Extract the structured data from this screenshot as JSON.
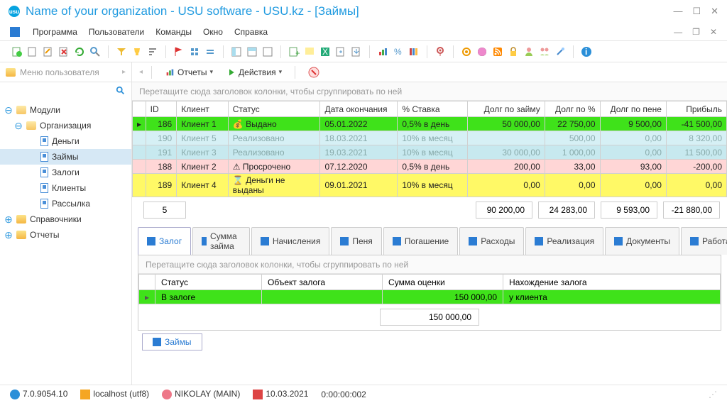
{
  "titlebar": {
    "title": "Name of your organization - USU software - USU.kz - [Займы]"
  },
  "menu": {
    "items": [
      "Программа",
      "Пользователи",
      "Команды",
      "Окно",
      "Справка"
    ]
  },
  "sidebar": {
    "header": "Меню пользователя",
    "items": [
      {
        "label": "Модули",
        "lvl": 0,
        "kind": "folder-open",
        "exp": "⊖"
      },
      {
        "label": "Организация",
        "lvl": 1,
        "kind": "folder-open",
        "exp": "⊖"
      },
      {
        "label": "Деньги",
        "lvl": 2,
        "kind": "doc"
      },
      {
        "label": "Займы",
        "lvl": 2,
        "kind": "doc",
        "sel": true
      },
      {
        "label": "Залоги",
        "lvl": 2,
        "kind": "doc"
      },
      {
        "label": "Клиенты",
        "lvl": 2,
        "kind": "doc"
      },
      {
        "label": "Рассылка",
        "lvl": 2,
        "kind": "doc"
      },
      {
        "label": "Справочники",
        "lvl": 0,
        "kind": "folder",
        "exp": "⊕"
      },
      {
        "label": "Отчеты",
        "lvl": 0,
        "kind": "folder",
        "exp": "⊕"
      }
    ]
  },
  "maintb": {
    "reports": "Отчеты",
    "actions": "Действия"
  },
  "group_hint": "Перетащите сюда заголовок колонки, чтобы сгруппировать по ней",
  "grid": {
    "headers": [
      "ID",
      "Клиент",
      "Статус",
      "Дата окончания",
      "% Ставка",
      "Долг по займу",
      "Долг по %",
      "Долг по пене",
      "Прибыль"
    ],
    "rows": [
      {
        "cls": "row-green",
        "ptr": "▸",
        "id": "186",
        "client": "Клиент 1",
        "status": "Выдано",
        "sicon": "issued",
        "date": "05.01.2022",
        "rate": "0,5% в день",
        "debt": "50 000,00",
        "pct": "22 750,00",
        "pen": "9 500,00",
        "profit": "-41 500,00",
        "pneg": true
      },
      {
        "cls": "row-cyan",
        "ptr": "",
        "id": "190",
        "client": "Клиент 5",
        "status": "Реализовано",
        "sicon": "",
        "date": "18.03.2021",
        "rate": "10% в месяц",
        "debt": "",
        "pct": "500,00",
        "pen": "0,00",
        "profit": "8 320,00"
      },
      {
        "cls": "row-cyan2",
        "ptr": "",
        "id": "191",
        "client": "Клиент 3",
        "status": "Реализовано",
        "sicon": "",
        "date": "19.03.2021",
        "rate": "10% в месяц",
        "debt": "30 000,00",
        "pct": "1 000,00",
        "pen": "0,00",
        "profit": "11 500,00"
      },
      {
        "cls": "row-pink",
        "ptr": "",
        "id": "188",
        "client": "Клиент 2",
        "status": "Просрочено",
        "sicon": "warn",
        "date": "07.12.2020",
        "rate": "0,5% в день",
        "debt": "200,00",
        "pct": "33,00",
        "pen": "93,00",
        "profit": "-200,00",
        "pneg": true
      },
      {
        "cls": "row-yellow",
        "ptr": "",
        "id": "189",
        "client": "Клиент 4",
        "status": "Деньги не выданы",
        "sicon": "hourglass",
        "date": "09.01.2021",
        "rate": "10% в месяц",
        "debt": "0,00",
        "pct": "0,00",
        "pen": "0,00",
        "profit": "0,00"
      }
    ],
    "sums": {
      "count": "5",
      "debt": "90 200,00",
      "pct": "24 283,00",
      "pen": "9 593,00",
      "profit": "-21 880,00"
    }
  },
  "tabs": [
    "Залог",
    "Сумма займа",
    "Начисления",
    "Пеня",
    "Погашение",
    "Расходы",
    "Реализация",
    "Документы",
    "Работа"
  ],
  "sub": {
    "headers": [
      "Статус",
      "Объект залога",
      "Сумма оценки",
      "Нахождение залога"
    ],
    "row": {
      "status": "В залоге",
      "obj": "",
      "sum": "150 000,00",
      "loc": "у клиента"
    },
    "total": "150 000,00"
  },
  "btmtab": "Займы",
  "status": {
    "ver": "7.0.9054.10",
    "host": "localhost (utf8)",
    "user": "NIKOLAY (MAIN)",
    "date": "10.03.2021",
    "time": "0:00:00:002"
  }
}
